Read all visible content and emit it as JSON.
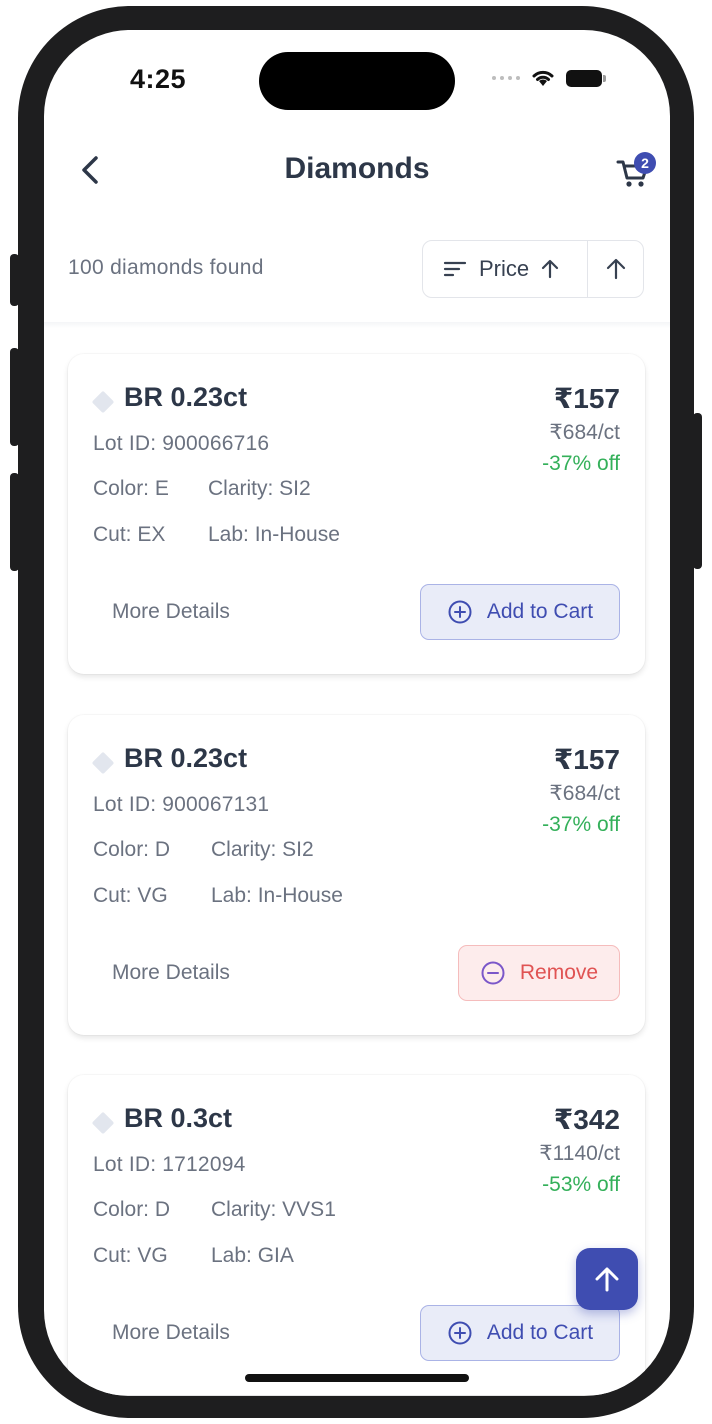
{
  "status_bar": {
    "time": "4:25"
  },
  "header": {
    "title": "Diamonds",
    "cart_count": "2"
  },
  "toolbar": {
    "results_text": "100 diamonds found",
    "sort_label": "Price"
  },
  "cards": [
    {
      "title": "BR 0.23ct",
      "price": "₹157",
      "per_ct": "₹684/ct",
      "discount": "-37% off",
      "lot": "Lot ID: 900066716",
      "color": "Color: E",
      "clarity": "Clarity: SI2",
      "cut": "Cut: EX",
      "lab": "Lab: In-House",
      "more": "More Details",
      "action": "Add to Cart"
    },
    {
      "title": "BR 0.23ct",
      "price": "₹157",
      "per_ct": "₹684/ct",
      "discount": "-37% off",
      "lot": "Lot ID: 900067131",
      "color": "Color: D",
      "clarity": "Clarity: SI2",
      "cut": "Cut: VG",
      "lab": "Lab: In-House",
      "more": "More Details",
      "action": "Remove"
    },
    {
      "title": "BR 0.3ct",
      "price": "₹342",
      "per_ct": "₹1140/ct",
      "discount": "-53% off",
      "lot": "Lot ID: 1712094",
      "color": "Color: D",
      "clarity": "Clarity: VVS1",
      "cut": "Cut: VG",
      "lab": "Lab: GIA",
      "more": "More Details",
      "action": "Add to Cart"
    }
  ],
  "icons": {
    "back": "chevron-left-icon",
    "cart": "cart-icon",
    "sort": "sort-lines-icon",
    "arrow_up": "arrow-up-icon",
    "add": "plus-circle-icon",
    "remove": "minus-circle-icon"
  },
  "colors": {
    "accent": "#3f4db1",
    "discount": "#34b05a",
    "remove": "#e05353",
    "text": "#2d3748"
  }
}
